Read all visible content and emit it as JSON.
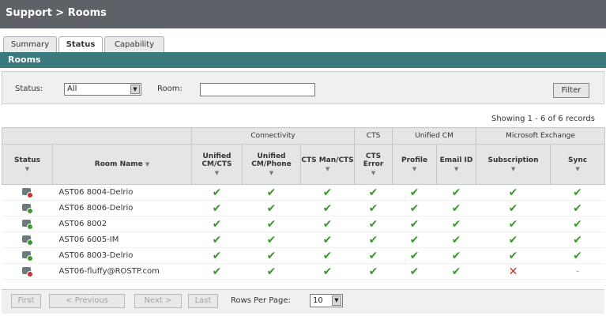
{
  "header": {
    "breadcrumb": "Support > Rooms"
  },
  "tabs": [
    {
      "label": "Summary"
    },
    {
      "label": "Status"
    },
    {
      "label": "Capability"
    }
  ],
  "section_title": "Rooms",
  "filter": {
    "status_label": "Status:",
    "status_value": "All",
    "room_label": "Room:",
    "room_value": "",
    "filter_button": "Filter"
  },
  "showing": "Showing 1 - 6 of 6 records",
  "table": {
    "groups": [
      "Connectivity",
      "CTS",
      "Unified CM",
      "Microsoft Exchange"
    ],
    "columns": {
      "status": "Status",
      "room_name": "Room Name",
      "unified_cm_cts": "Unified CM/CTS",
      "unified_cm_phone": "Unified CM/Phone",
      "cts_man_cts": "CTS Man/CTS",
      "cts_error": "CTS Error",
      "profile": "Profile",
      "email_id": "Email ID",
      "subscription": "Subscription",
      "sync": "Sync"
    },
    "rows": [
      {
        "status": "error",
        "name": "AST06 8004-Delrio",
        "vals": [
          "ok",
          "ok",
          "ok",
          "ok",
          "ok",
          "ok",
          "ok",
          "ok"
        ]
      },
      {
        "status": "ok",
        "name": "AST06 8006-Delrio",
        "vals": [
          "ok",
          "ok",
          "ok",
          "ok",
          "ok",
          "ok",
          "ok",
          "ok"
        ]
      },
      {
        "status": "ok",
        "name": "AST06 8002",
        "vals": [
          "ok",
          "ok",
          "ok",
          "ok",
          "ok",
          "ok",
          "ok",
          "ok"
        ]
      },
      {
        "status": "ok",
        "name": "AST06 6005-IM",
        "vals": [
          "ok",
          "ok",
          "ok",
          "ok",
          "ok",
          "ok",
          "ok",
          "ok"
        ]
      },
      {
        "status": "ok",
        "name": "AST06 8003-Delrio",
        "vals": [
          "ok",
          "ok",
          "ok",
          "ok",
          "ok",
          "ok",
          "ok",
          "ok"
        ]
      },
      {
        "status": "error",
        "name": "AST06-fluffy@ROSTP.com",
        "vals": [
          "ok",
          "ok",
          "ok",
          "ok",
          "ok",
          "ok",
          "fail",
          "none"
        ]
      }
    ]
  },
  "pager": {
    "first": "First",
    "previous": "< Previous",
    "next": "Next >",
    "last": "Last",
    "rows_per_page_label": "Rows Per Page:",
    "rows_per_page_value": "10"
  },
  "symbols": {
    "ok": "✔",
    "fail": "✕",
    "none": "–"
  },
  "colors": {
    "header_bar": "#5f6168",
    "section_bar": "#3a7a7c",
    "ok": "#3a9a2a",
    "fail": "#c8312c"
  }
}
